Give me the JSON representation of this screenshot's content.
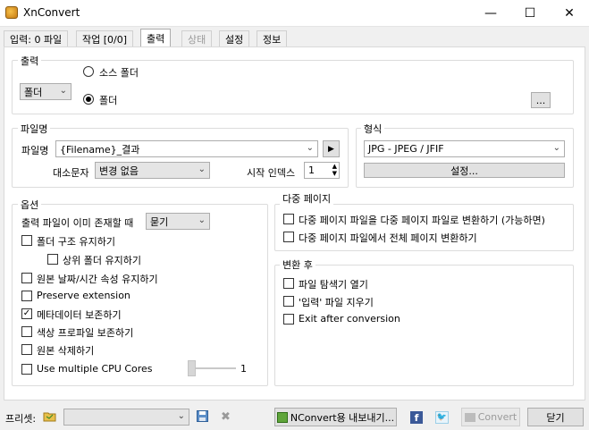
{
  "window": {
    "title": "XnConvert",
    "minimize": "—",
    "maximize": "☐",
    "close": "✕"
  },
  "tabs": [
    {
      "label": "입력: 0 파일"
    },
    {
      "label": "작업 [0/0]"
    },
    {
      "label": "출력"
    },
    {
      "label": "상태"
    },
    {
      "label": "설정"
    },
    {
      "label": "정보"
    }
  ],
  "output": {
    "group_label": "출력",
    "dest_select": "폴더",
    "radio_source": "소스 폴더",
    "radio_folder": "폴더",
    "selected": "폴더",
    "browse_label": "..."
  },
  "filename": {
    "group_label": "파일명",
    "field_label": "파일명",
    "value": "{Filename}_결과",
    "case_label": "대소문자",
    "case_value": "변경 없음",
    "start_index_label": "시작 인덱스",
    "start_index_value": "1"
  },
  "format": {
    "group_label": "형식",
    "value": "JPG - JPEG / JFIF",
    "settings_label": "설정..."
  },
  "options": {
    "group_label": "옵션",
    "exists_label": "출력 파일이 이미 존재할 때",
    "exists_value": "묻기",
    "items": [
      {
        "label": "폴더 구조 유지하기",
        "checked": false
      },
      {
        "label": "상위 폴더 유지하기",
        "checked": false
      },
      {
        "label": "원본 날짜/시간 속성 유지하기",
        "checked": false
      },
      {
        "label": "Preserve extension",
        "checked": false
      },
      {
        "label": "메타데이터 보존하기",
        "checked": true
      },
      {
        "label": "색상 프로파일 보존하기",
        "checked": false
      },
      {
        "label": "원본 삭제하기",
        "checked": false
      },
      {
        "label": "Use multiple CPU Cores",
        "checked": false
      }
    ],
    "cpu_cores_value": "1"
  },
  "multipage": {
    "group_label": "다중 페이지",
    "items": [
      {
        "label": "다중 페이지 파일을 다중 페이지 파일로 변환하기 (가능하면)",
        "checked": false
      },
      {
        "label": "다중 페이지 파일에서 전체 페이지 변환하기",
        "checked": false
      }
    ]
  },
  "after": {
    "group_label": "변환 후",
    "items": [
      {
        "label": "파일 탐색기 열기",
        "checked": false
      },
      {
        "label": "'입력' 파일 지우기",
        "checked": false
      },
      {
        "label": "Exit after conversion",
        "checked": false
      }
    ]
  },
  "bottom": {
    "preset_label": "프리셋:",
    "preset_value": "",
    "export_label": "NConvert용 내보내기...",
    "convert_label": "Convert",
    "close_label": "닫기"
  },
  "colors": {
    "accent": "#0078d7",
    "facebook": "#3b5998",
    "twitter": "#1da1f2"
  }
}
